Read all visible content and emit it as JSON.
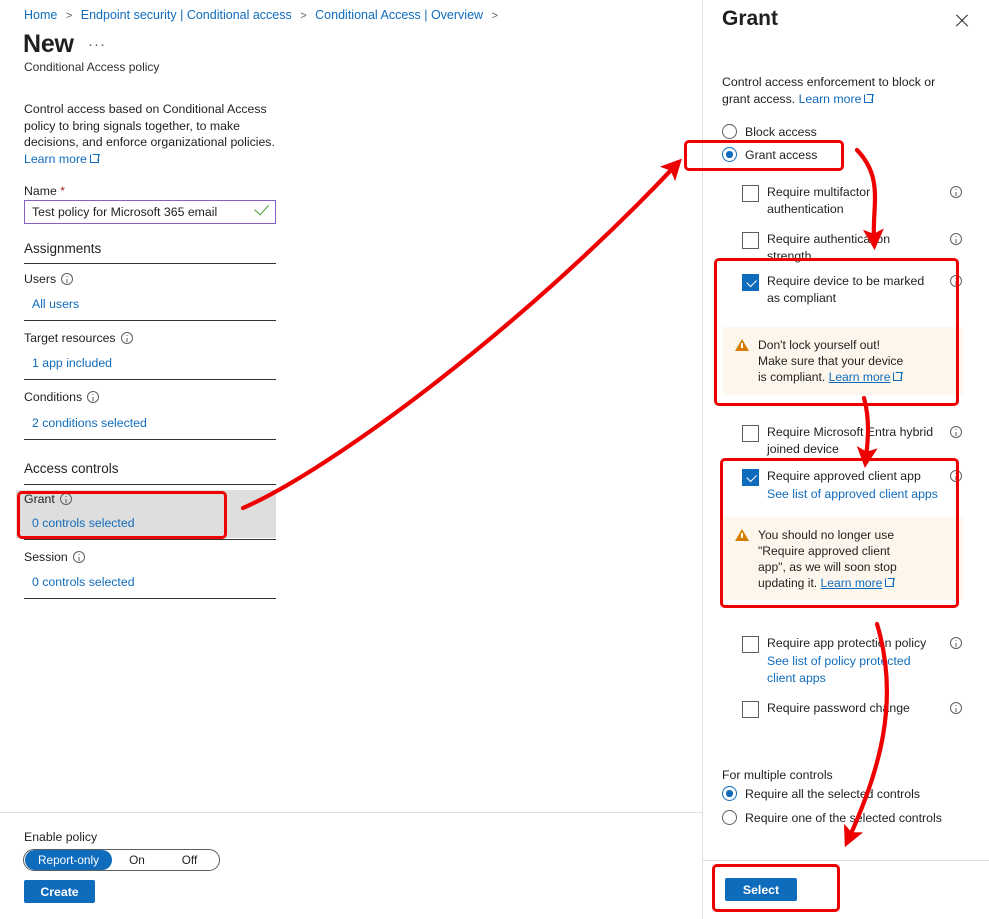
{
  "breadcrumb": {
    "items": [
      "Home",
      "Endpoint security | Conditional access",
      "Conditional Access | Overview"
    ],
    "separator": ">"
  },
  "left": {
    "title": "New",
    "title_ellipsis": "···",
    "subtitle": "Conditional Access policy",
    "intro_text": "Control access based on Conditional Access policy to bring signals together, to make decisions, and enforce organizational policies.",
    "learn_more": "Learn more",
    "name_label": "Name",
    "name_required_mark": "*",
    "name_value": "Test policy for Microsoft 365 email",
    "assignments_heading": "Assignments",
    "rows": [
      {
        "label": "Users",
        "value": "All users"
      },
      {
        "label": "Target resources",
        "value": "1 app included"
      },
      {
        "label": "Conditions",
        "value": "2 conditions selected"
      }
    ],
    "access_controls_heading": "Access controls",
    "access_rows": [
      {
        "label": "Grant",
        "value": "0 controls selected"
      },
      {
        "label": "Session",
        "value": "0 controls selected"
      }
    ],
    "enable_policy_label": "Enable policy",
    "toggle_options": [
      "Report-only",
      "On",
      "Off"
    ],
    "toggle_selected": "Report-only",
    "create_button": "Create"
  },
  "grant_panel": {
    "title": "Grant",
    "close_label": "Close",
    "description": "Control access enforcement to block or grant access.",
    "description_link": "Learn more",
    "access_radios": [
      {
        "label": "Block access",
        "selected": false
      },
      {
        "label": "Grant access",
        "selected": true
      }
    ],
    "controls": [
      {
        "label": "Require multifactor authentication",
        "checked": false
      },
      {
        "label": "Require authentication strength",
        "checked": false
      },
      {
        "label": "Require device to be marked as compliant",
        "checked": true,
        "warning": "Don't lock yourself out! Make sure that your device is compliant.",
        "warning_link": "Learn more"
      },
      {
        "label": "Require Microsoft Entra hybrid joined device",
        "checked": false
      },
      {
        "label": "Require approved client app",
        "checked": true,
        "sublink": "See list of approved client apps",
        "warning": "You should no longer use \"Require approved client app\", as we will soon stop updating it.",
        "warning_link": "Learn more"
      },
      {
        "label": "Require app protection policy",
        "checked": false,
        "sublink": "See list of policy protected client apps"
      },
      {
        "label": "Require password change",
        "checked": false
      }
    ],
    "multiple_controls_label": "For multiple controls",
    "multiple_controls_radios": [
      {
        "label": "Require all the selected controls",
        "selected": true
      },
      {
        "label": "Require one of the selected controls",
        "selected": false
      }
    ],
    "select_button": "Select"
  },
  "annotation": {
    "color": "#ee0000"
  }
}
